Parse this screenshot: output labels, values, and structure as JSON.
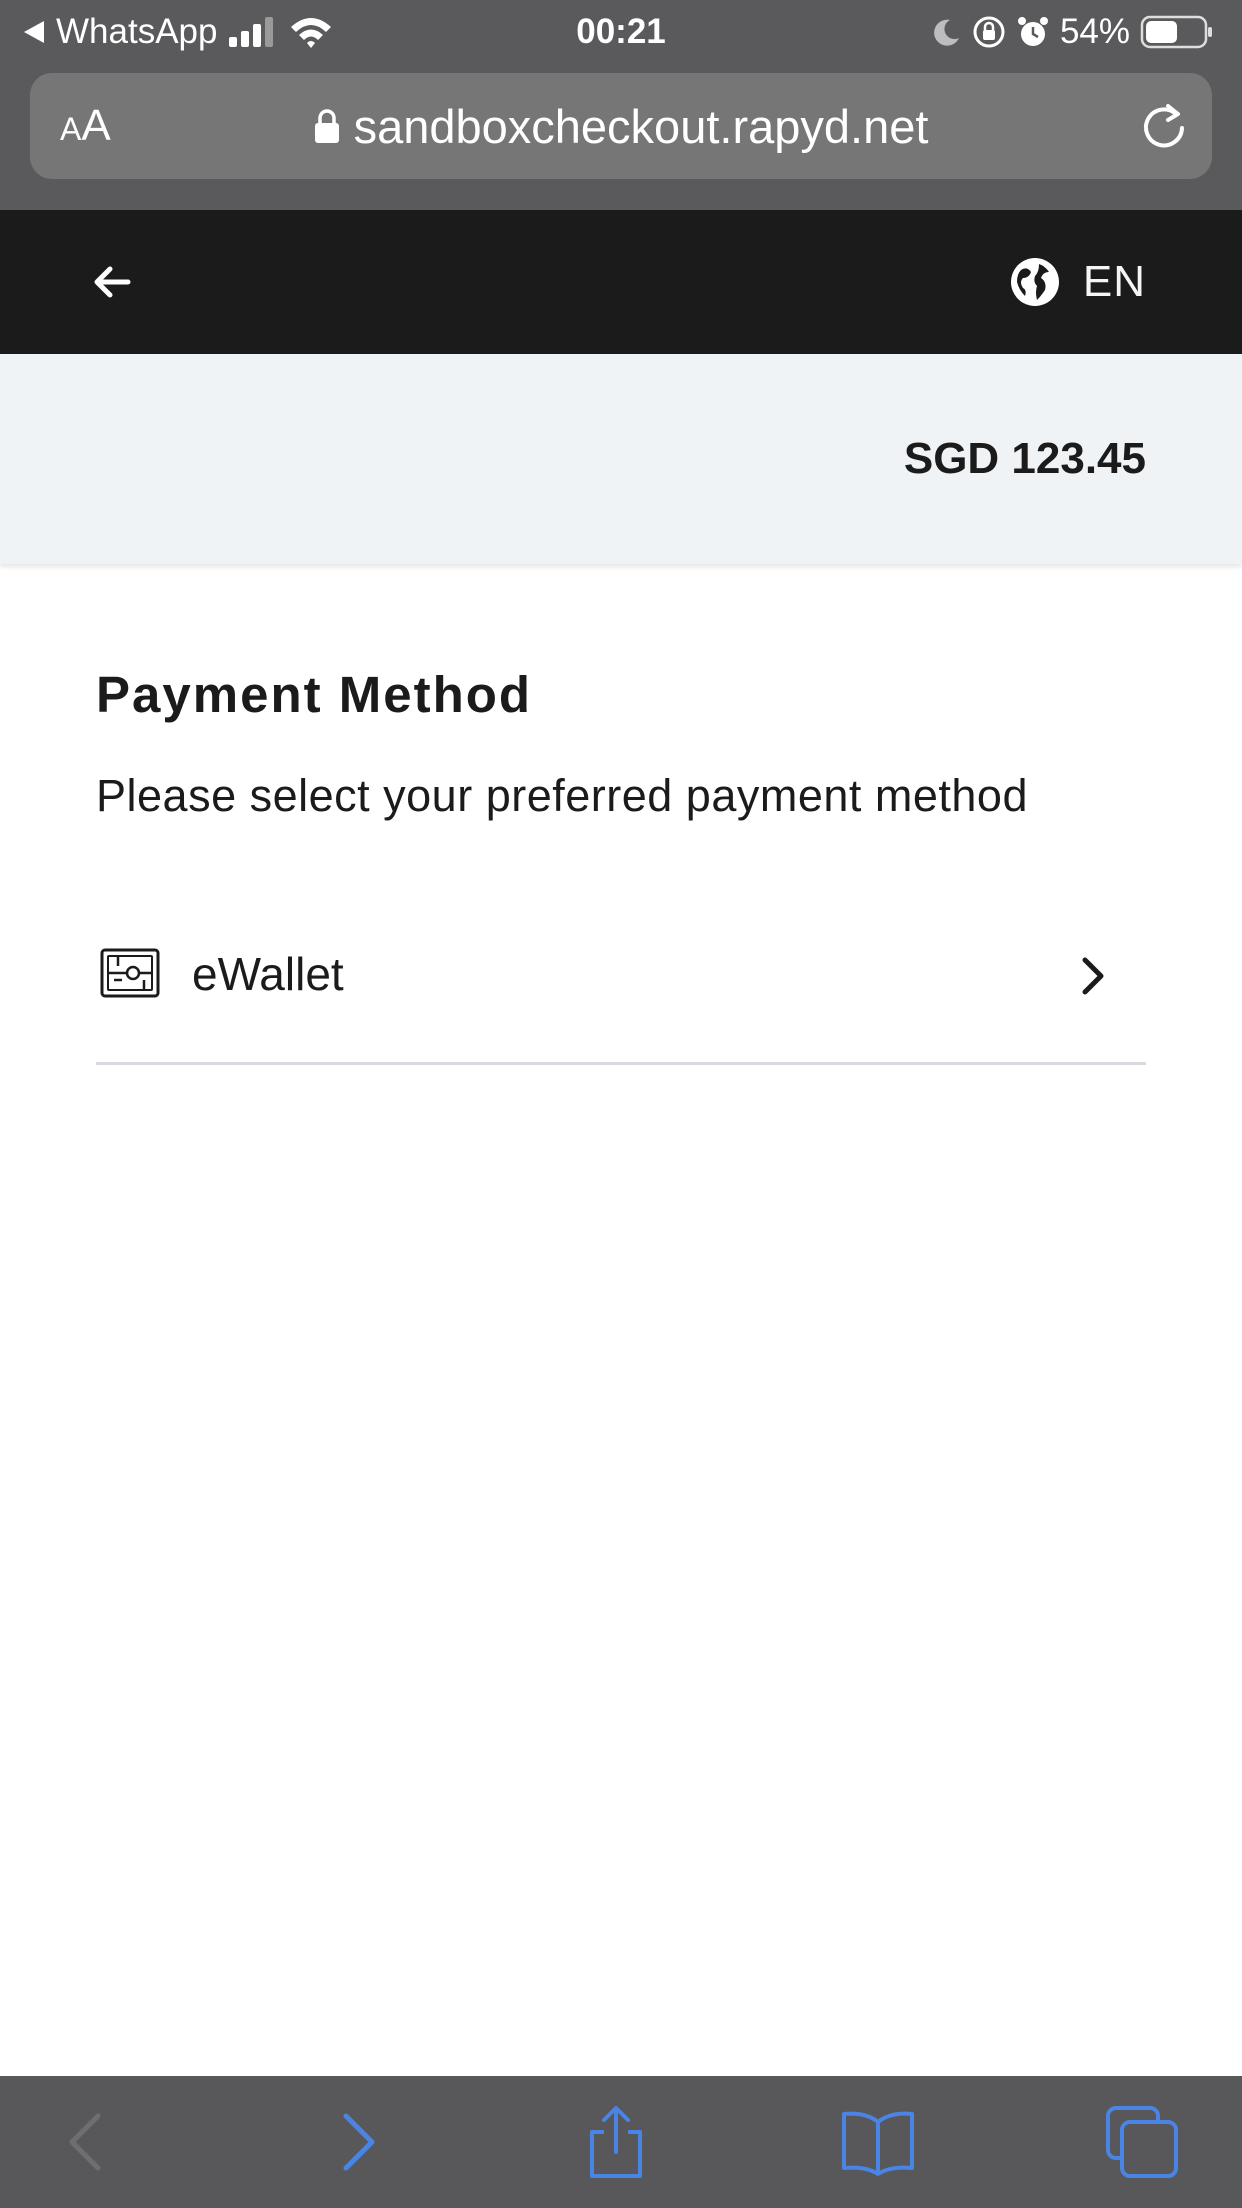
{
  "status_bar": {
    "back_app": "WhatsApp",
    "time": "00:21",
    "battery": "54%"
  },
  "url_bar": {
    "text_size_label_small": "A",
    "text_size_label_large": "A",
    "url": "sandboxcheckout.rapyd.net"
  },
  "header": {
    "language": "EN"
  },
  "summary": {
    "amount": "SGD 123.45"
  },
  "payment": {
    "title": "Payment Method",
    "subtitle": "Please select your preferred payment method",
    "methods": [
      {
        "label": "eWallet",
        "icon": "ewallet-icon"
      }
    ]
  },
  "colors": {
    "browser_chrome": "#5a5a5c",
    "header_bg": "#1b1b1b",
    "summary_bg": "#f0f3f6",
    "toolbar_accent": "#4a84e4"
  }
}
